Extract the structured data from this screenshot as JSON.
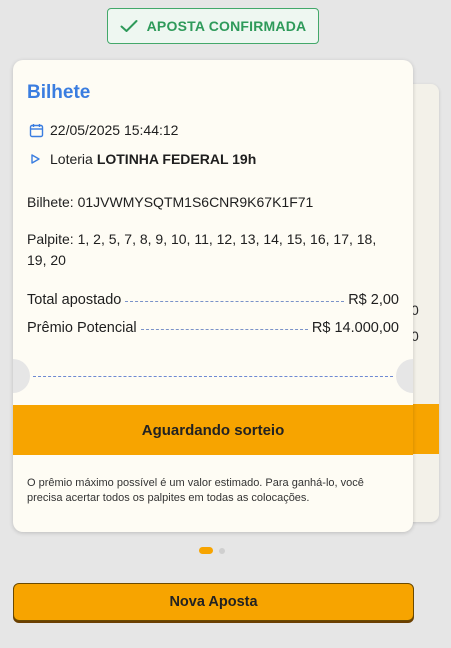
{
  "badge": {
    "label": "APOSTA CONFIRMADA",
    "icon": "check-icon",
    "color": "#2e9a5a"
  },
  "ticket": {
    "title": "Bilhete",
    "datetime": "22/05/2025 15:44:12",
    "lottery_prefix": "Loteria",
    "lottery_name": "LOTINHA FEDERAL 19h",
    "bilhete_label": "Bilhete:",
    "bilhete_code": "01JVWMYSQTM1S6CNR9K67K1F71",
    "palpite_label": "Palpite:",
    "palpite_values": "1, 2, 5, 7, 8, 9, 10, 11, 12, 13, 14, 15, 16, 17, 18, 19, 20",
    "total_label": "Total apostado",
    "total_value": "R$ 2,00",
    "premio_label": "Prêmio Potencial",
    "premio_value": "R$ 14.000,00",
    "status": "Aguardando sorteio",
    "disclaimer": "O prêmio máximo possível é um valor estimado. Para ganhá-lo, você precisa acertar todos os palpites em todas as colocações."
  },
  "back_card": {
    "fragment_1": "0",
    "fragment_2": "0"
  },
  "pager": {
    "total": 2,
    "active": 1
  },
  "actions": {
    "nova_aposta": "Nova Aposta"
  },
  "colors": {
    "accent": "#f7a400",
    "title_blue": "#3a7de0",
    "background": "#e6e6e6"
  }
}
